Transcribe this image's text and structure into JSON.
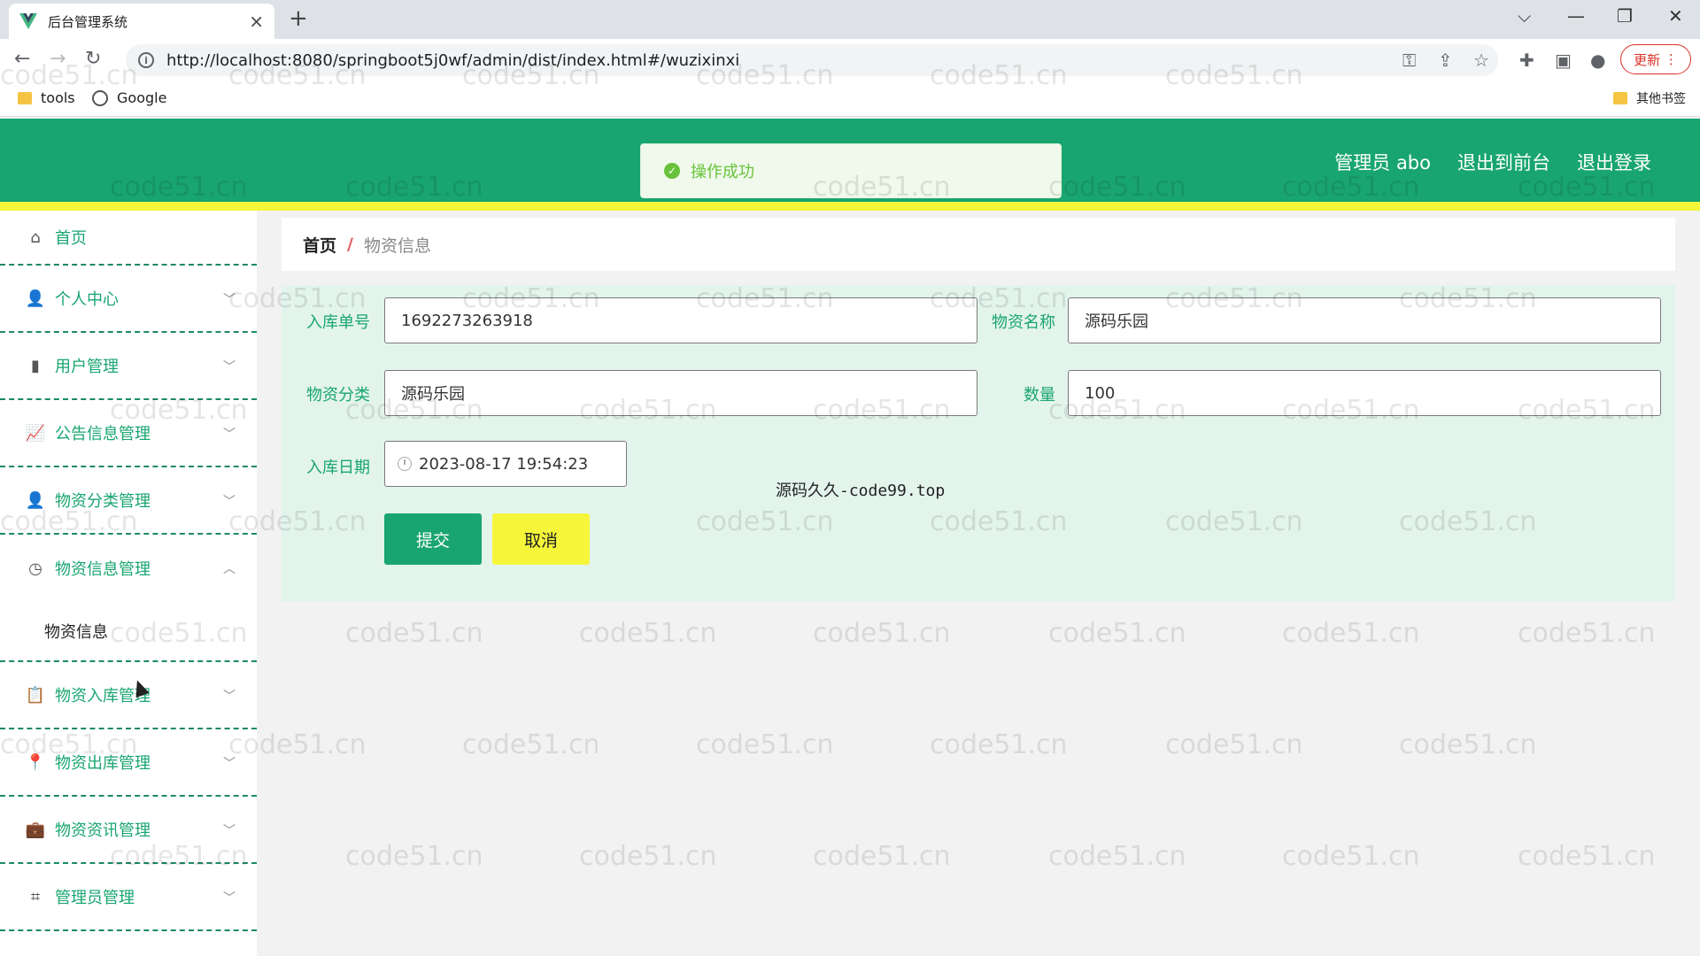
{
  "browser": {
    "tab_title": "后台管理系统",
    "tab_close": "×",
    "new_tab": "+",
    "url": "http://localhost:8080/springboot5j0wf/admin/dist/index.html#/wuzixinxi",
    "update_label": "更新",
    "bookmarks": [
      "tools",
      "Google"
    ],
    "other_bookmarks": "其他书签"
  },
  "header": {
    "admin_label": "管理员 abo",
    "to_front_label": "退出到前台",
    "logout_label": "退出登录",
    "toast": "操作成功"
  },
  "sidebar": {
    "items": [
      {
        "label": "首页",
        "icon": "home-icon"
      },
      {
        "label": "个人中心",
        "icon": "user-icon"
      },
      {
        "label": "用户管理",
        "icon": "users-icon"
      },
      {
        "label": "公告信息管理",
        "icon": "chart-icon"
      },
      {
        "label": "物资分类管理",
        "icon": "person-icon"
      },
      {
        "label": "物资信息管理",
        "icon": "clock-icon"
      },
      {
        "label": "物资入库管理",
        "icon": "clipboard-icon"
      },
      {
        "label": "物资出库管理",
        "icon": "pin-icon"
      },
      {
        "label": "物资资讯管理",
        "icon": "briefcase-icon"
      },
      {
        "label": "管理员管理",
        "icon": "crop-icon"
      }
    ],
    "submenu": "物资信息"
  },
  "breadcrumb": {
    "home": "首页",
    "sep": "/",
    "current": "物资信息"
  },
  "form": {
    "order_no_label": "入库单号",
    "order_no_value": "1692273263918",
    "name_label": "物资名称",
    "name_value": "源码乐园",
    "category_label": "物资分类",
    "category_value": "源码乐园",
    "qty_label": "数量",
    "qty_value": "100",
    "date_label": "入库日期",
    "date_value": "2023-08-17 19:54:23",
    "submit_label": "提交",
    "cancel_label": "取消"
  },
  "overlay_text": "源码久久-code99.top",
  "watermark": "code51.cn",
  "colors": {
    "primary": "#19a571",
    "accent_yellow": "#f5f53a",
    "panel_bg": "#e3f4ec"
  }
}
